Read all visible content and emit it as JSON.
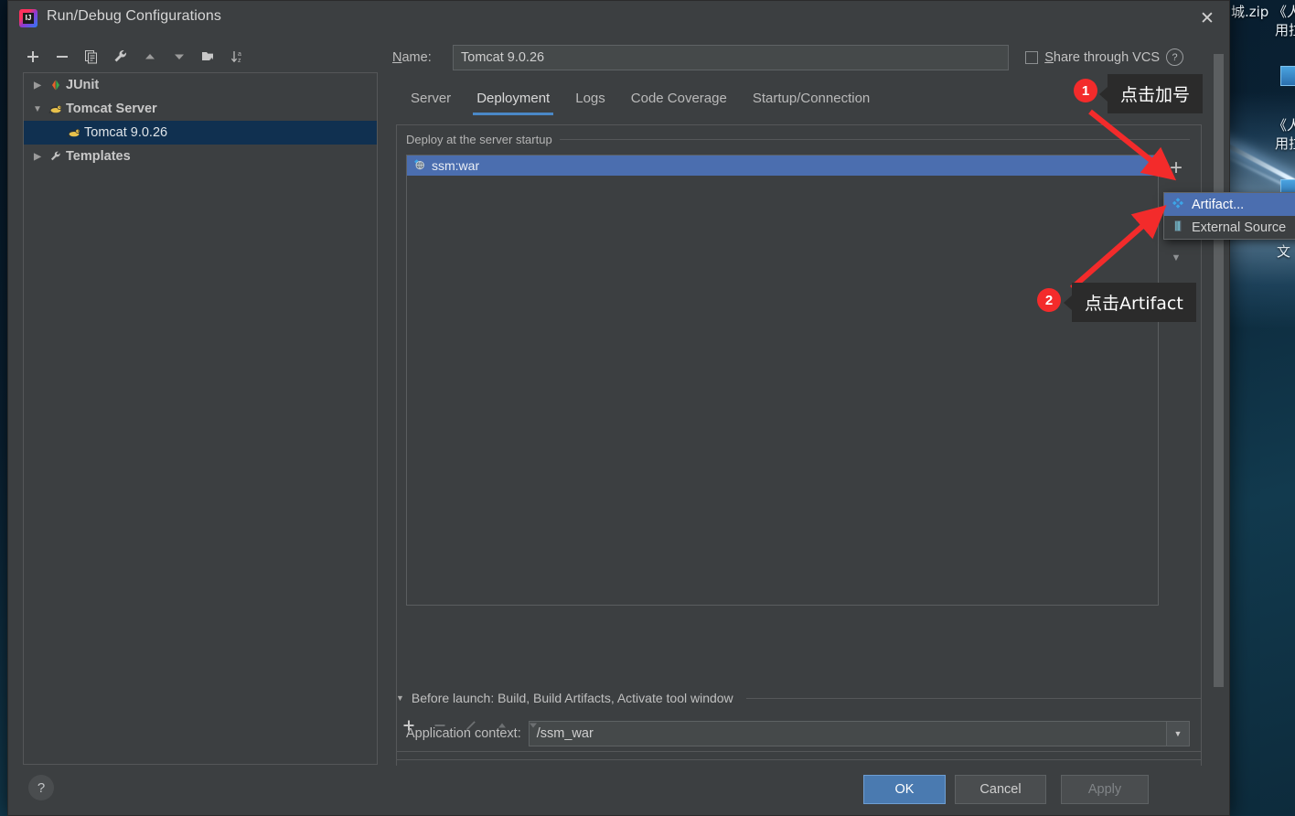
{
  "window": {
    "title": "Run/Debug Configurations",
    "app_icon": "intellij-idea-icon",
    "close_icon": "close-icon"
  },
  "left_toolbar": {
    "buttons": [
      {
        "name": "add-configuration-button",
        "icon": "plus-icon",
        "label": "+"
      },
      {
        "name": "remove-configuration-button",
        "icon": "minus-icon",
        "label": "−"
      },
      {
        "name": "copy-configuration-button",
        "icon": "copy-icon",
        "label": ""
      },
      {
        "name": "edit-templates-button",
        "icon": "wrench-icon",
        "label": ""
      },
      {
        "name": "move-up-button",
        "icon": "arrow-up-icon",
        "label": ""
      },
      {
        "name": "move-down-button",
        "icon": "arrow-down-icon",
        "label": ""
      },
      {
        "name": "new-folder-button",
        "icon": "folder-add-icon",
        "label": ""
      },
      {
        "name": "sort-configurations-button",
        "icon": "sort-az-icon",
        "label": ""
      }
    ]
  },
  "tree": {
    "items": [
      {
        "label": "JUnit",
        "twisty": "▶",
        "icon": "junit-icon",
        "level": 0,
        "bold": true,
        "selected": false
      },
      {
        "label": "Tomcat Server",
        "twisty": "▼",
        "icon": "tomcat-icon",
        "level": 0,
        "bold": true,
        "selected": false
      },
      {
        "label": "Tomcat 9.0.26",
        "twisty": "",
        "icon": "tomcat-icon",
        "level": 1,
        "bold": false,
        "selected": true
      },
      {
        "label": "Templates",
        "twisty": "▶",
        "icon": "wrench-icon",
        "level": 0,
        "bold": true,
        "selected": false
      }
    ]
  },
  "form": {
    "name_label": "Name:",
    "name_label_mnemonic": "N",
    "name_value": "Tomcat 9.0.26",
    "share_label": "Share through VCS",
    "share_label_mnemonic": "S",
    "share_checked": false,
    "share_help_icon": "question-mark-icon"
  },
  "tabs": {
    "items": [
      {
        "label": "Server",
        "active": false
      },
      {
        "label": "Deployment",
        "active": true
      },
      {
        "label": "Logs",
        "active": false
      },
      {
        "label": "Code Coverage",
        "active": false
      },
      {
        "label": "Startup/Connection",
        "active": false
      }
    ]
  },
  "deployment": {
    "legend": "Deploy at the server startup",
    "artifacts": [
      {
        "label": "ssm:war",
        "icon": "artifact-war-icon",
        "selected": true
      }
    ],
    "side_buttons": [
      {
        "name": "add-artifact-button",
        "icon": "plus-icon",
        "label": "+"
      },
      {
        "name": "artifact-dropdown-button",
        "icon": "chevron-down-icon",
        "label": "▼"
      }
    ],
    "app_context_label": "Application context:",
    "app_context_value": "/ssm_war",
    "app_context_dropdown_icon": "chevron-down-icon"
  },
  "popup_menu": {
    "items": [
      {
        "label": "Artifact...",
        "icon": "artifact-icon",
        "selected": true
      },
      {
        "label": "External Source",
        "icon": "external-source-icon",
        "selected": false
      }
    ]
  },
  "before_launch": {
    "twisty": "▼",
    "title": "Before launch: Build, Build Artifacts, Activate tool window",
    "title_mnemonic": "B",
    "buttons": [
      {
        "name": "before-launch-add-button",
        "icon": "plus-icon",
        "label": "+",
        "dim": false
      },
      {
        "name": "before-launch-remove-button",
        "icon": "minus-icon",
        "label": "−",
        "dim": true
      },
      {
        "name": "before-launch-edit-button",
        "icon": "pencil-icon",
        "label": "",
        "dim": true
      },
      {
        "name": "before-launch-move-up-button",
        "icon": "arrow-up-icon",
        "label": "▲",
        "dim": true
      },
      {
        "name": "before-launch-move-down-button",
        "icon": "arrow-down-icon",
        "label": "▼",
        "dim": true
      }
    ]
  },
  "footer": {
    "help_icon": "question-mark-icon",
    "ok_label": "OK",
    "cancel_label": "Cancel",
    "apply_label": "Apply",
    "apply_enabled": false
  },
  "annotations": [
    {
      "badge": "1",
      "text": "点击加号"
    },
    {
      "badge": "2",
      "text": "点击Artifact"
    }
  ],
  "desktop": {
    "labels": [
      {
        "text": "城.zip"
      },
      {
        "text": "《人"
      },
      {
        "text": "用拉"
      },
      {
        "text": "《人"
      },
      {
        "text": "用拉"
      },
      {
        "text": "文"
      }
    ]
  },
  "colors": {
    "dialog_bg": "#3c3f41",
    "accent_blue": "#4b6eaf",
    "tab_underline": "#4a88c7",
    "selection_tree": "#103050",
    "annotation_red": "#f32b2b",
    "ok_button": "#4a7ab0"
  }
}
